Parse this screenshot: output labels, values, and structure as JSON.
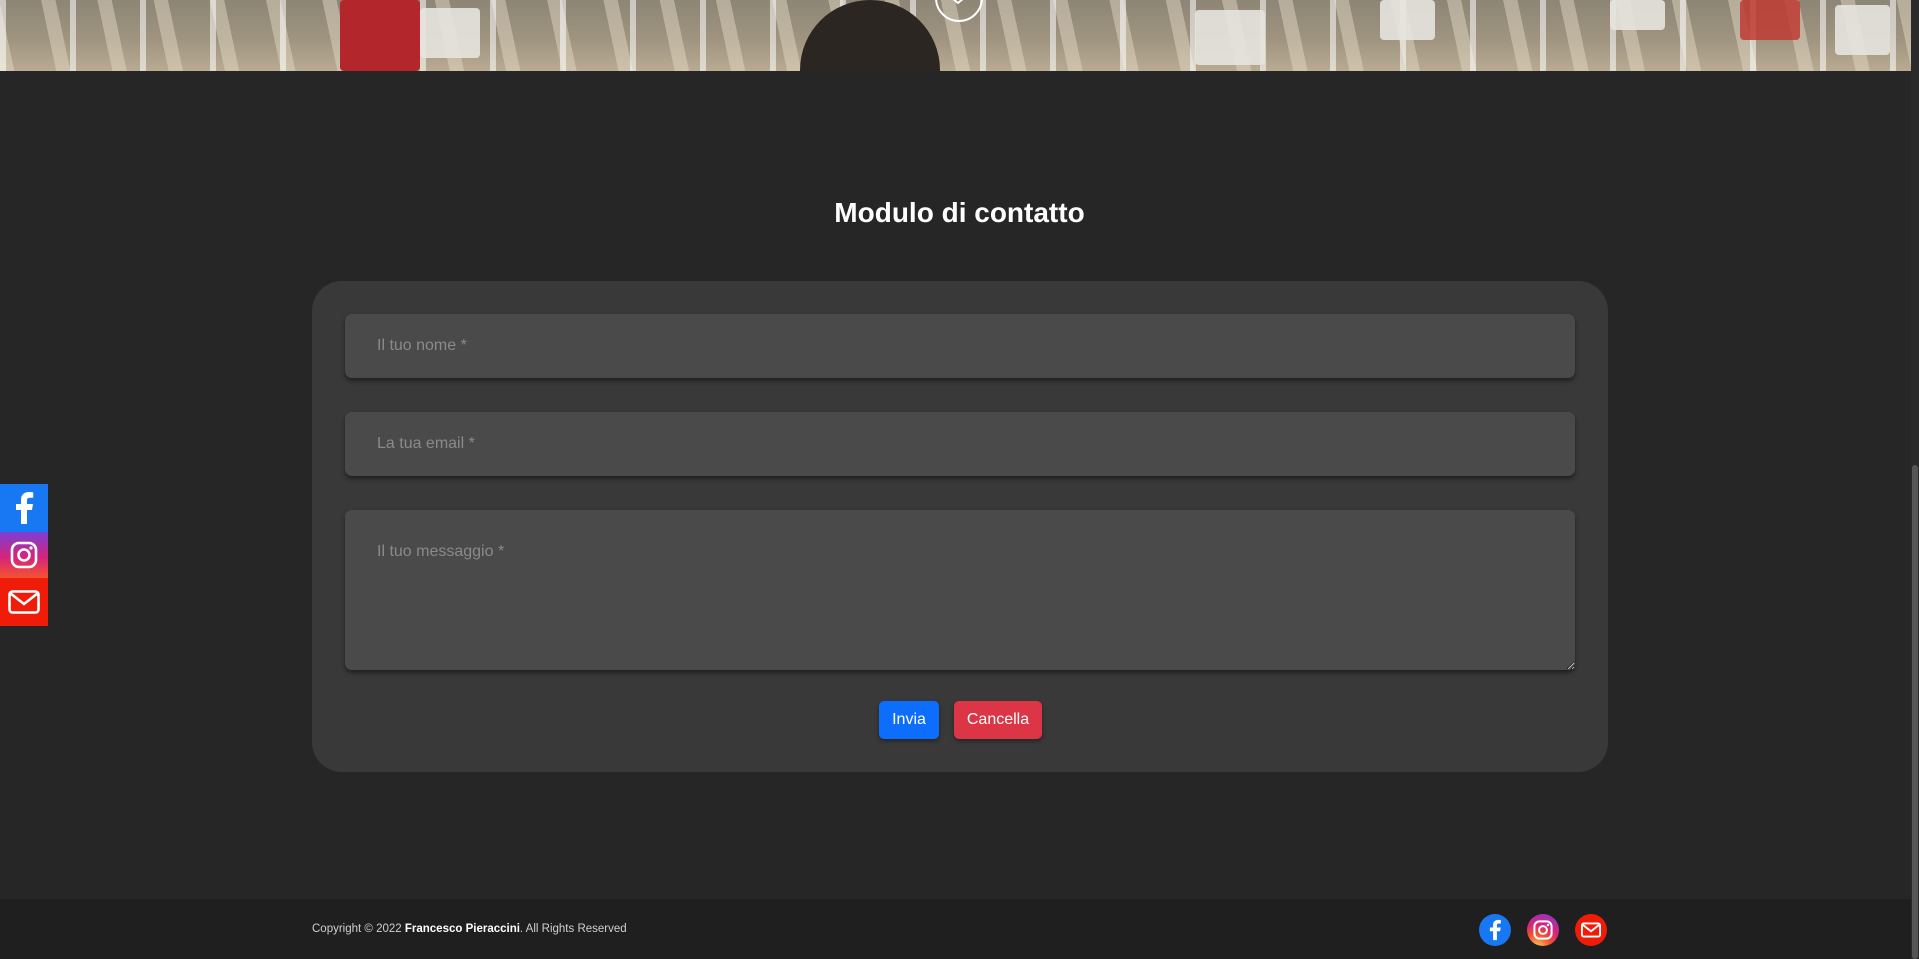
{
  "contact": {
    "title": "Modulo di contatto",
    "name_placeholder": "Il tuo nome *",
    "email_placeholder": "La tua email *",
    "message_placeholder": "Il tuo messaggio *",
    "send_label": "Invia",
    "cancel_label": "Cancella"
  },
  "footer": {
    "copyright_prefix": "Copyright © 2022 ",
    "author": "Francesco Pieraccini",
    "copyright_suffix": ". All Rights Reserved"
  },
  "social": {
    "items": [
      {
        "icon": "facebook-icon",
        "color": "#1877f2"
      },
      {
        "icon": "instagram-icon",
        "color": "#d6247b"
      },
      {
        "icon": "mail-icon",
        "color": "#ef1c0a"
      }
    ]
  },
  "colors": {
    "background": "#262626",
    "card": "#393939",
    "field": "#4a4a4a",
    "send_button": "#0d6efd",
    "cancel_button": "#dc3545",
    "footer": "#1f1f1f"
  }
}
